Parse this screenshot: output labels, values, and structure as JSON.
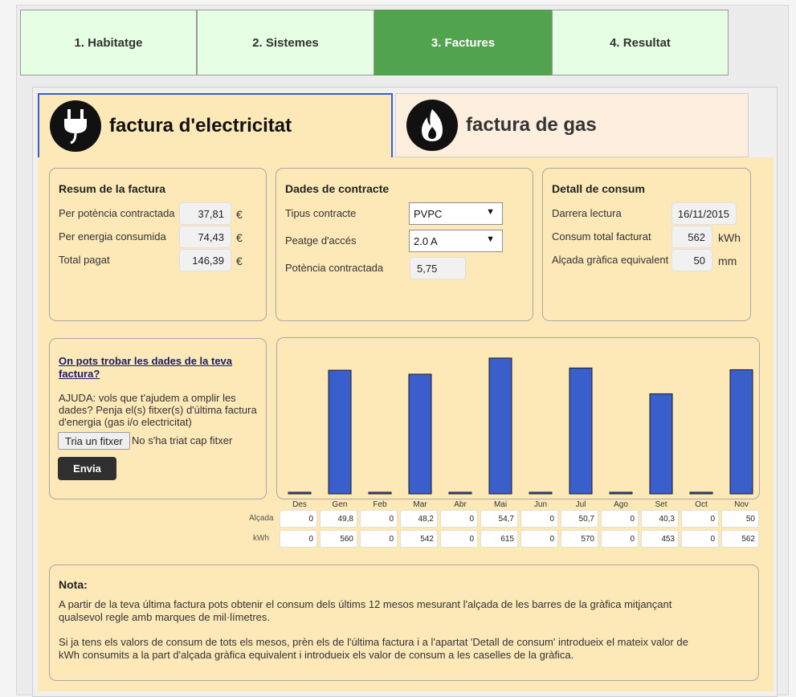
{
  "tabs": [
    {
      "label": "1. Habitatge"
    },
    {
      "label": "2. Sistemes"
    },
    {
      "label": "3. Factures"
    },
    {
      "label": "4. Resultat"
    }
  ],
  "subtabs": {
    "electricity": "factura d'electricitat",
    "gas": "factura de gas"
  },
  "resum": {
    "title": "Resum de la factura",
    "rows": [
      {
        "label": "Per potència contractada",
        "value": "37,81",
        "unit": "€"
      },
      {
        "label": "Per energia consumida",
        "value": "74,43",
        "unit": "€"
      },
      {
        "label": "Total pagat",
        "value": "146,39",
        "unit": "€"
      }
    ]
  },
  "contracte": {
    "title": "Dades de contracte",
    "tipus_label": "Tipus contracte",
    "tipus_value": "PVPC",
    "peatge_label": "Peatge d'accés",
    "peatge_value": "2.0 A",
    "potencia_label": "Potència contractada",
    "potencia_value": "5,75"
  },
  "detall": {
    "title": "Detall de consum",
    "lectura_label": "Darrera lectura",
    "lectura_value": "16/11/2015",
    "consum_label": "Consum total facturat",
    "consum_value": "562",
    "consum_unit": "kWh",
    "alcada_label": "Alçada gràfica equivalent",
    "alcada_value": "50",
    "alcada_unit": "mm"
  },
  "help": {
    "link": "On pots trobar les dades de la teva factura?",
    "text": "AJUDA: vols que t'ajudem a omplir les dades? Penja el(s) fitxer(s) d'última factura d'energia (gas i/o electricitat)",
    "file_button": "Tria un fitxer",
    "no_file": "No s'ha triat cap fitxer",
    "send": "Envia"
  },
  "row_labels": {
    "alcada": "Alçada",
    "kwh": "kWh"
  },
  "alcada_values": [
    "0",
    "49,8",
    "0",
    "48,2",
    "0",
    "54,7",
    "0",
    "50,7",
    "0",
    "40,3",
    "0",
    "50"
  ],
  "kwh_values": [
    "0",
    "560",
    "0",
    "542",
    "0",
    "615",
    "0",
    "570",
    "0",
    "453",
    "0",
    "562"
  ],
  "chart_data": {
    "type": "bar",
    "categories": [
      "Des",
      "Gen",
      "Feb",
      "Mar",
      "Abr",
      "Mai",
      "Jun",
      "Jul",
      "Ago",
      "Set",
      "Oct",
      "Nov"
    ],
    "values": [
      0,
      49.8,
      0,
      48.2,
      0,
      54.7,
      0,
      50.7,
      0,
      40.3,
      0,
      50
    ],
    "title": "",
    "xlabel": "",
    "ylabel": "",
    "ylim": [
      0,
      55
    ],
    "grid": false,
    "bar_color": "#3a5fcd"
  },
  "nota": {
    "title": "Nota:",
    "p1": "A partir de la teva última factura pots obtenir el consum dels últims 12 mesos mesurant l'alçada de les barres de la gràfica mitjançant qualsevol regle amb marques de mil·límetres.",
    "p2": "Si ja tens els valors de consum de tots els mesos, prèn els de l'última factura i a l'apartat 'Detall de consum' introdueix el mateix valor de kWh consumits a la part d'alçada gràfica equivalent i introdueix els valor de consum a les caselles de la gràfica."
  },
  "colors": {
    "active_tab": "#52a350",
    "tab_bg": "#e6fee3",
    "content_bg": "#fde8b8",
    "bar": "#3a5fcd"
  }
}
